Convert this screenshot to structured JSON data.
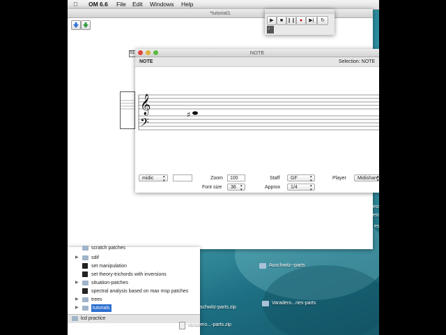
{
  "menubar": {
    "app": "OM 6.6",
    "items": [
      "File",
      "Edit",
      "Windows",
      "Help"
    ]
  },
  "patch_window": {
    "title": "*tutorial1",
    "box_label": "S1"
  },
  "note_editor": {
    "title": "NOTE",
    "header_label": "NOTE",
    "selection_text": "Selection: NOTE",
    "controls": {
      "midic": "midic",
      "zoom_label": "Zoom",
      "zoom_value": "100",
      "fontsize_label": "Font size",
      "fontsize_value": "36",
      "staff_label": "Staff",
      "staff_value": "GF",
      "approx_label": "Approx",
      "approx_value": "1/4",
      "player_label": "Player",
      "player_value": "Midishare"
    }
  },
  "finder_list": [
    {
      "label": "scratch patches",
      "kind": "folder"
    },
    {
      "label": "sdif",
      "kind": "folder"
    },
    {
      "label": "set manipulation",
      "kind": "patch"
    },
    {
      "label": "set theory-trichords with inversions",
      "kind": "patch"
    },
    {
      "label": "situation-patches",
      "kind": "folder"
    },
    {
      "label": "spectral analysis based on max msp patches",
      "kind": "patch"
    },
    {
      "label": "trees",
      "kind": "folder"
    },
    {
      "label": "tutorials",
      "kind": "folder"
    },
    {
      "label": "",
      "kind": "folder"
    }
  ],
  "finder_bottom": "lcd practice",
  "desktop": {
    "auschwitz_folder": "Auschwitz--parts",
    "auschwitz_zip": "schwitz-parts.zip",
    "varadero_folder": "Varadero...ries-parts",
    "varadero_zip": "Varadero...-parts.zip",
    "side_snippets": [
      "ess",
      "ess",
      "e",
      "ess"
    ]
  },
  "colors": {
    "accent_blue": "#2a6fd6",
    "accent_green": "#2e9b3a",
    "selected_row": "#2c6fd0"
  }
}
